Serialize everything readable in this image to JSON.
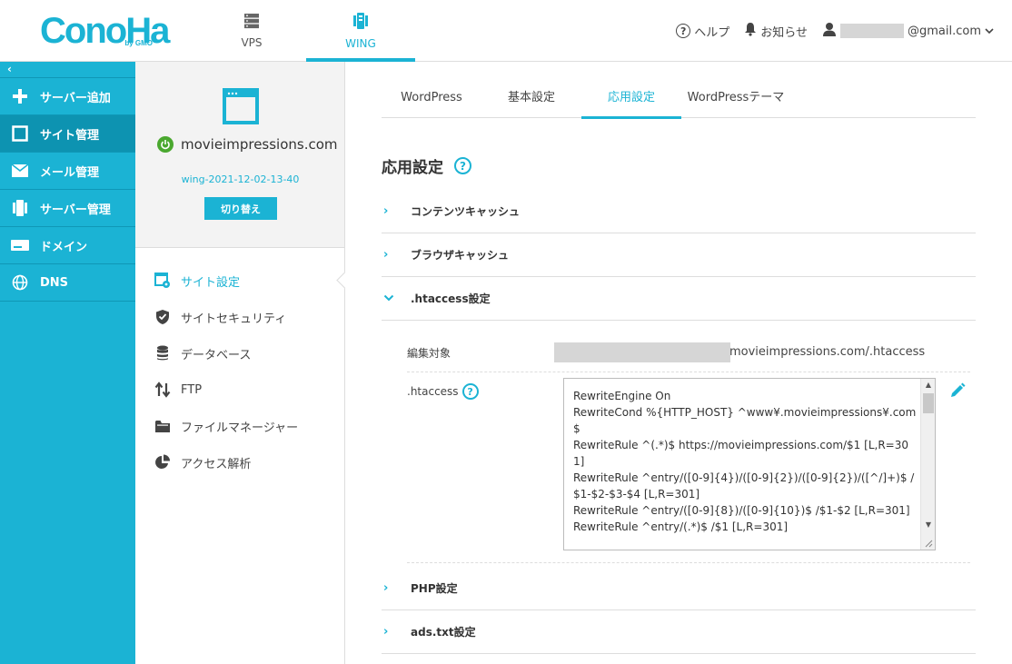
{
  "header": {
    "logo_text": "ConoHa",
    "logo_sub": "by GMO",
    "nav": [
      {
        "label": "VPS",
        "icon": "server-icon",
        "active": false
      },
      {
        "label": "WING",
        "icon": "wing-icon",
        "active": true
      }
    ],
    "help_label": "ヘルプ",
    "notice_label": "お知らせ",
    "account_email_suffix": "@gmail.com"
  },
  "sidebar": {
    "collapse_label": "‹",
    "items": [
      {
        "label": "サーバー追加",
        "icon": "plus-icon"
      },
      {
        "label": "サイト管理",
        "icon": "site-icon",
        "active": true
      },
      {
        "label": "メール管理",
        "icon": "mail-icon"
      },
      {
        "label": "サーバー管理",
        "icon": "server-manage-icon"
      },
      {
        "label": "ドメイン",
        "icon": "domain-icon"
      },
      {
        "label": "DNS",
        "icon": "globe-icon"
      }
    ]
  },
  "site": {
    "name": "movieimpressions.com",
    "id": "wing-2021-12-02-13-40",
    "switch_label": "切り替え",
    "menu": [
      {
        "label": "サイト設定",
        "icon": "site-settings-icon",
        "active": true
      },
      {
        "label": "サイトセキュリティ",
        "icon": "shield-icon"
      },
      {
        "label": "データベース",
        "icon": "database-icon"
      },
      {
        "label": "FTP",
        "icon": "ftp-icon"
      },
      {
        "label": "ファイルマネージャー",
        "icon": "folder-icon"
      },
      {
        "label": "アクセス解析",
        "icon": "pie-chart-icon"
      }
    ]
  },
  "tabs": [
    {
      "label": "WordPress"
    },
    {
      "label": "基本設定"
    },
    {
      "label": "応用設定",
      "active": true
    },
    {
      "label": "WordPressテーマ"
    }
  ],
  "section_title": "応用設定",
  "accordions": {
    "content_cache": "コンテンツキャッシュ",
    "browser_cache": "ブラウザキャッシュ",
    "htaccess": ".htaccess設定",
    "php": "PHP設定",
    "ads": "ads.txt設定"
  },
  "htaccess": {
    "target_label": "編集対象",
    "target_path": "movieimpressions.com/.htaccess",
    "field_label": ".htaccess",
    "lines": [
      "RewriteEngine On",
      "RewriteCond %{HTTP_HOST} ^www¥.movieimpressions¥.com$",
      "RewriteRule ^(.*)$ https://movieimpressions.com/$1 [L,R=301]",
      "RewriteRule ^entry/([0-9]{4})/([0-9]{2})/([0-9]{2})/([^/]+)$ /$1-$2-$3-$4 [L,R=301]",
      "RewriteRule ^entry/([0-9]{8})/([0-9]{10})$ /$1-$2 [L,R=301]",
      "RewriteRule ^entry/(.*)$ /$1 [L,R=301]"
    ]
  },
  "colors": {
    "accent": "#1bb3d4",
    "sidebar_active": "#0d93b1",
    "power": "#4aa82f"
  }
}
